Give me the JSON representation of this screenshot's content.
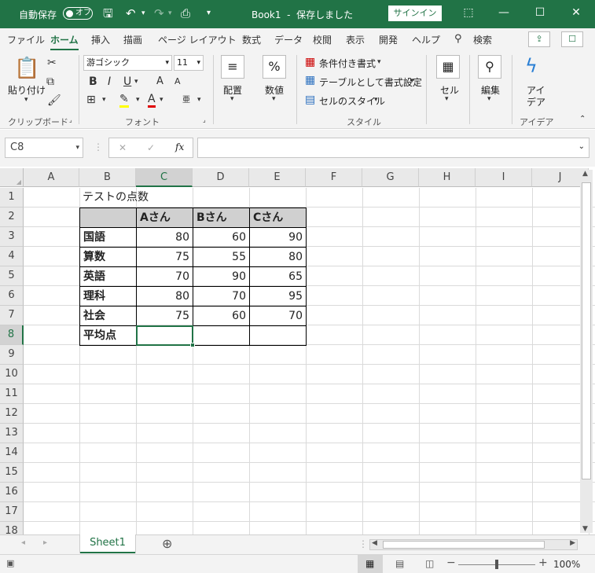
{
  "titlebar": {
    "autosave_label": "自動保存",
    "autosave_state": "オフ",
    "doc_title": "Book1",
    "separator": "-",
    "save_state": "保存しました",
    "signin_label": "サインイン"
  },
  "tabs": [
    "ファイル",
    "ホーム",
    "挿入",
    "描画",
    "ページ レイアウト",
    "数式",
    "データ",
    "校閲",
    "表示",
    "開発",
    "ヘルプ",
    "検索"
  ],
  "active_tab": "ホーム",
  "ribbon": {
    "clipboard": {
      "paste_label": "貼り付け",
      "group_label": "クリップボード"
    },
    "font": {
      "font_name": "游ゴシック",
      "font_size": "11",
      "group_label": "フォント",
      "bold": "B",
      "italic": "I",
      "underline": "U",
      "grow": "A",
      "shrink": "A",
      "font_color_letter": "A"
    },
    "alignment": {
      "label": "配置"
    },
    "number": {
      "label": "数値",
      "symbol": "%"
    },
    "styles": {
      "conditional": "条件付き書式",
      "table": "テーブルとして書式設定",
      "cell_styles": "セルのスタイル",
      "group_label": "スタイル"
    },
    "cells": {
      "label": "セル"
    },
    "editing": {
      "label": "編集"
    },
    "ideas": {
      "label_line1": "アイ",
      "label_line2": "デア",
      "group_label": "アイデア"
    }
  },
  "formula_bar": {
    "name_box": "C8",
    "fx": "fx",
    "cancel": "✕",
    "enter": "✓",
    "content": ""
  },
  "columns": [
    "A",
    "B",
    "C",
    "D",
    "E",
    "F",
    "G",
    "H",
    "I",
    "J"
  ],
  "rows": [
    "1",
    "2",
    "3",
    "4",
    "5",
    "6",
    "7",
    "8",
    "9",
    "10",
    "11",
    "12",
    "13",
    "14",
    "15",
    "16",
    "17",
    "18"
  ],
  "sheet": {
    "title": "テストの点数",
    "headers": [
      "Aさん",
      "Bさん",
      "Cさん"
    ],
    "subjects": [
      "国語",
      "算数",
      "英語",
      "理科",
      "社会"
    ],
    "scores": [
      [
        "80",
        "60",
        "90"
      ],
      [
        "75",
        "55",
        "80"
      ],
      [
        "70",
        "90",
        "65"
      ],
      [
        "80",
        "70",
        "95"
      ],
      [
        "75",
        "60",
        "70"
      ]
    ],
    "average_label": "平均点"
  },
  "sheet_tabs": [
    "Sheet1"
  ],
  "status": {
    "zoom": "100%"
  }
}
